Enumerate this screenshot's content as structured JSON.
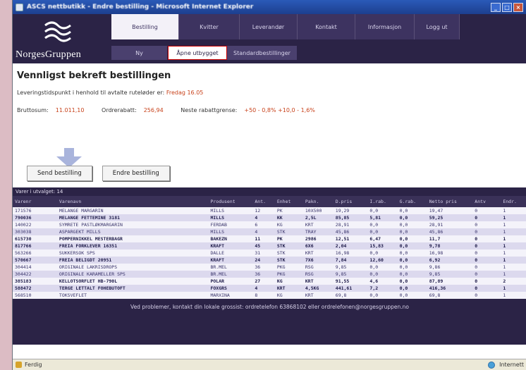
{
  "window": {
    "title": "ASCS nettbutikk - Endre bestilling - Microsoft Internet Explorer"
  },
  "brand": {
    "name": "NorgesGruppen"
  },
  "nav": {
    "top": [
      "Bestilling",
      "Kvitter",
      "Leverandør",
      "Kontakt",
      "Informasjon",
      "Logg ut"
    ],
    "sub": [
      "Ny",
      "Åpne utbygget",
      "Standardbestillinger"
    ]
  },
  "page": {
    "heading": "Vennligst bekreft bestillingen",
    "delivery_text": "Leveringstidspunkt i henhold til avtalte ruteløder er:",
    "delivery_date": "Fredag 16.05",
    "gross_label": "Bruttosum:",
    "gross_value": "11.011,10",
    "discount_label": "Ordrerabatt:",
    "discount_value": "256,94",
    "next_label": "Neste rabattgrense:",
    "next_value": "+50 - 0,8% +10,0 - 1,6%",
    "send_btn": "Send bestilling",
    "edit_btn": "Endre bestilling"
  },
  "table": {
    "info": "Varer i utvalget: 14",
    "headers": [
      "Varenr",
      "Varenavn",
      "Produsent",
      "Ant.",
      "Enhet",
      "Pakn.",
      "D.pris",
      "I.rab.",
      "G.rab.",
      "Netto pris",
      "Antv",
      "Endr."
    ],
    "rows": [
      {
        "bold": false,
        "cells": [
          "171576",
          "MELANGE MARGARIN",
          "MILLS",
          "12",
          "PK",
          "10X500",
          "19,29",
          "0,0",
          "0,0",
          "19,47",
          "0",
          "1"
        ]
      },
      {
        "bold": true,
        "cells": [
          "790036",
          "MELANGE FETTEMINE 3181",
          "MILLS",
          "4",
          "KK",
          "2,5L",
          "85,85",
          "5,81",
          "0,0",
          "59,25",
          "0",
          "1"
        ]
      },
      {
        "bold": false,
        "cells": [
          "140022",
          "SYMRETE PASTLØKMARGARIN",
          "FERDAB",
          "6",
          "KG",
          "KRT",
          "28,91",
          "0,0",
          "0,0",
          "28,91",
          "0",
          "1"
        ]
      },
      {
        "bold": false,
        "cells": [
          "303038",
          "ASPARGEKT MILLS",
          "MILLS",
          "4",
          "STK",
          "TRAY",
          "45,86",
          "0,0",
          "0,0",
          "45,86",
          "0",
          "1"
        ]
      },
      {
        "bold": true,
        "cells": [
          "615730",
          "POMPERNIKKEL MESTERBAGR",
          "BAKEZN",
          "11",
          "PK",
          "2986",
          "12,51",
          "6,47",
          "0,0",
          "11,7",
          "0",
          "1"
        ]
      },
      {
        "bold": true,
        "cells": [
          "817766",
          "FREIA FORKLEVER 16351",
          "KRAFT",
          "45",
          "STK",
          "6X6",
          "2,04",
          "15,83",
          "0,0",
          "9,78",
          "0",
          "1"
        ]
      },
      {
        "bold": false,
        "cells": [
          "563266",
          "SUKKERSOK SPS",
          "DALLE",
          "31",
          "STK",
          "KRT",
          "16,98",
          "0,0",
          "0,0",
          "16,98",
          "0",
          "1"
        ]
      },
      {
        "bold": true,
        "cells": [
          "570667",
          "FREIA BELIGDT 20951",
          "KRAFT",
          "24",
          "STK",
          "7X6",
          "7,84",
          "12,60",
          "0,0",
          "6,92",
          "0",
          "1"
        ]
      },
      {
        "bold": false,
        "cells": [
          "304414",
          "ORIGINALE LAKRISDROPS",
          "BR.MEL",
          "36",
          "PKG",
          "RSG",
          "9,85",
          "0,0",
          "0,0",
          "9,86",
          "0",
          "1"
        ]
      },
      {
        "bold": false,
        "cells": [
          "304422",
          "ORIGINALE KARAMELLER SPS",
          "BR.MEL",
          "36",
          "PKG",
          "RSG",
          "9,85",
          "0,0",
          "0,0",
          "9,85",
          "0",
          "1"
        ]
      },
      {
        "bold": true,
        "cells": [
          "385183",
          "KELLOTSORFLET HB-790L",
          "POLAR",
          "27",
          "KG",
          "KRT",
          "91,55",
          "4,6",
          "0,0",
          "87,89",
          "0",
          "2"
        ]
      },
      {
        "bold": true,
        "cells": [
          "588472",
          "TERGE LETTALT FOHEBUTOFT",
          "FOXGRS",
          "4",
          "KRT",
          "4,5KG",
          "441,61",
          "7,2",
          "0,0",
          "416,36",
          "0",
          "1"
        ]
      },
      {
        "bold": false,
        "cells": [
          "568510",
          "TOKSVEFLET",
          "MARXINA",
          "8",
          "KG",
          "KRT",
          "69,8",
          "0,0",
          "0,0",
          "69,8",
          "0",
          "1"
        ]
      }
    ]
  },
  "footer": {
    "text": "Ved problemer, kontakt din lokale grossist: ordretelefon 63868102 eller ordrelefonen@norgesgruppen.no"
  },
  "statusbar": {
    "left": "Ferdig",
    "right": "Internett"
  }
}
